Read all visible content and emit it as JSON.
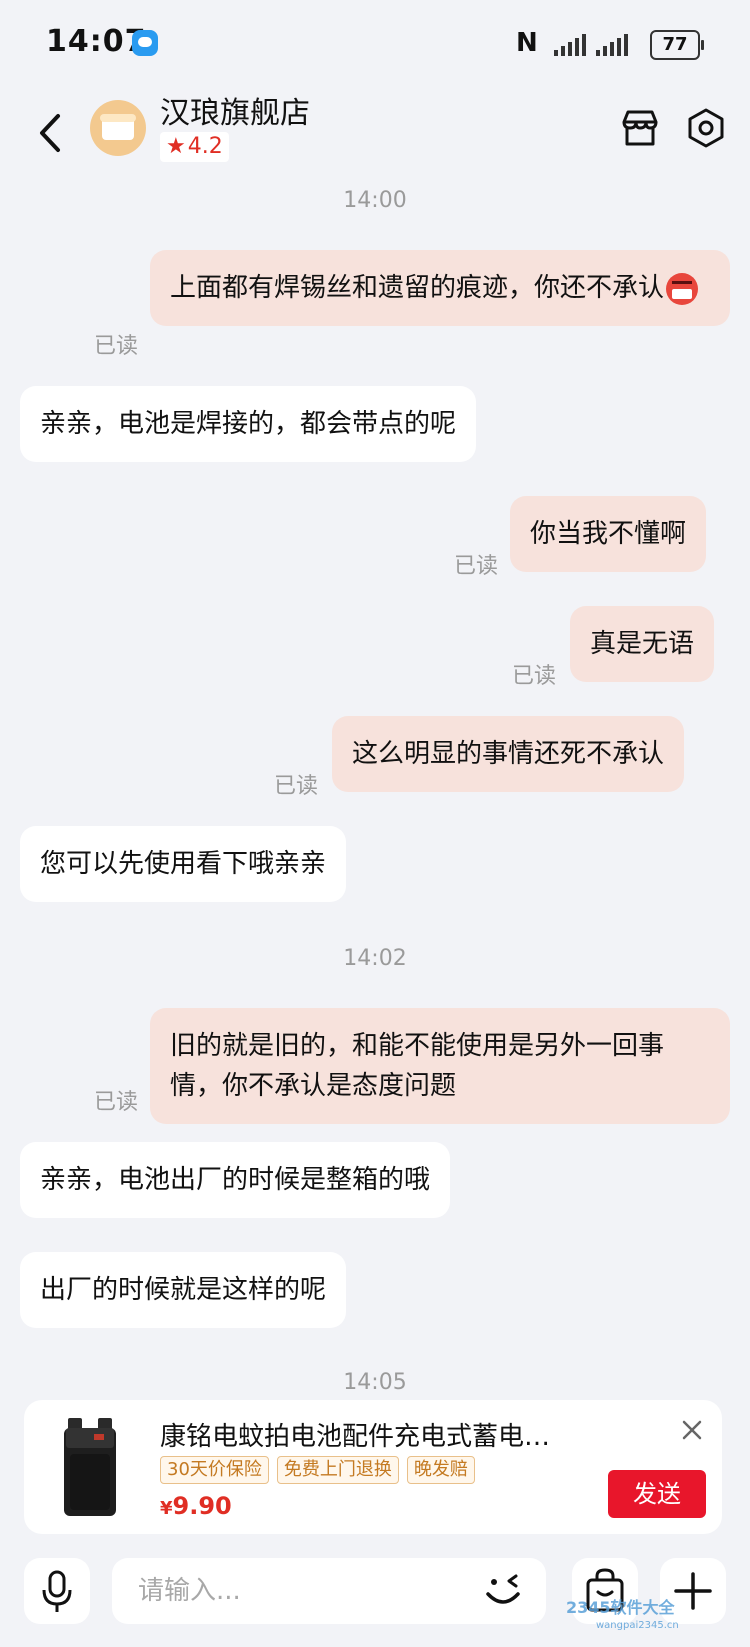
{
  "status_bar": {
    "time": "14:07",
    "battery": "77",
    "nfc": "N"
  },
  "header": {
    "shop_name": "汉琅旗舰店",
    "rating": "4.2"
  },
  "chat": [
    {
      "type": "time",
      "text": "14:00"
    },
    {
      "type": "message",
      "sender": "me",
      "text": "上面都有焊锡丝和遗留的痕迹，你还不承认",
      "emoji": "angry-face",
      "read_status": "已读"
    },
    {
      "type": "message",
      "sender": "shop",
      "text": "亲亲，电池是焊接的，都会带点的呢"
    },
    {
      "type": "message",
      "sender": "me",
      "text": "你当我不懂啊",
      "read_status": "已读"
    },
    {
      "type": "message",
      "sender": "me",
      "text": "真是无语",
      "read_status": "已读"
    },
    {
      "type": "message",
      "sender": "me",
      "text": "这么明显的事情还死不承认",
      "read_status": "已读"
    },
    {
      "type": "message",
      "sender": "shop",
      "text": "您可以先使用看下哦亲亲"
    },
    {
      "type": "time",
      "text": "14:02"
    },
    {
      "type": "message",
      "sender": "me",
      "text": "旧的就是旧的，和能不能使用是另外一回事情，你不承认是态度问题",
      "read_status": "已读"
    },
    {
      "type": "message",
      "sender": "shop",
      "text": "亲亲，电池出厂的时候是整箱的哦"
    },
    {
      "type": "message",
      "sender": "shop",
      "text": "出厂的时候就是这样的呢"
    },
    {
      "type": "time",
      "text": "14:05"
    }
  ],
  "product_card": {
    "title": "康铭电蚊拍电池配件充电式蓄电…",
    "tags": [
      "30天价保险",
      "免费上门退换",
      "晚发赔"
    ],
    "price_symbol": "¥",
    "price": "9.90",
    "send_label": "发送"
  },
  "input_bar": {
    "placeholder": "请输入..."
  },
  "watermark": {
    "text": "2345软件大全",
    "subtext": "wangpai2345.cn"
  },
  "colors": {
    "my_bubble": "#f7e2dc",
    "shop_bubble": "#ffffff",
    "accent_red": "#e8162b",
    "background": "#f2f3f7"
  }
}
